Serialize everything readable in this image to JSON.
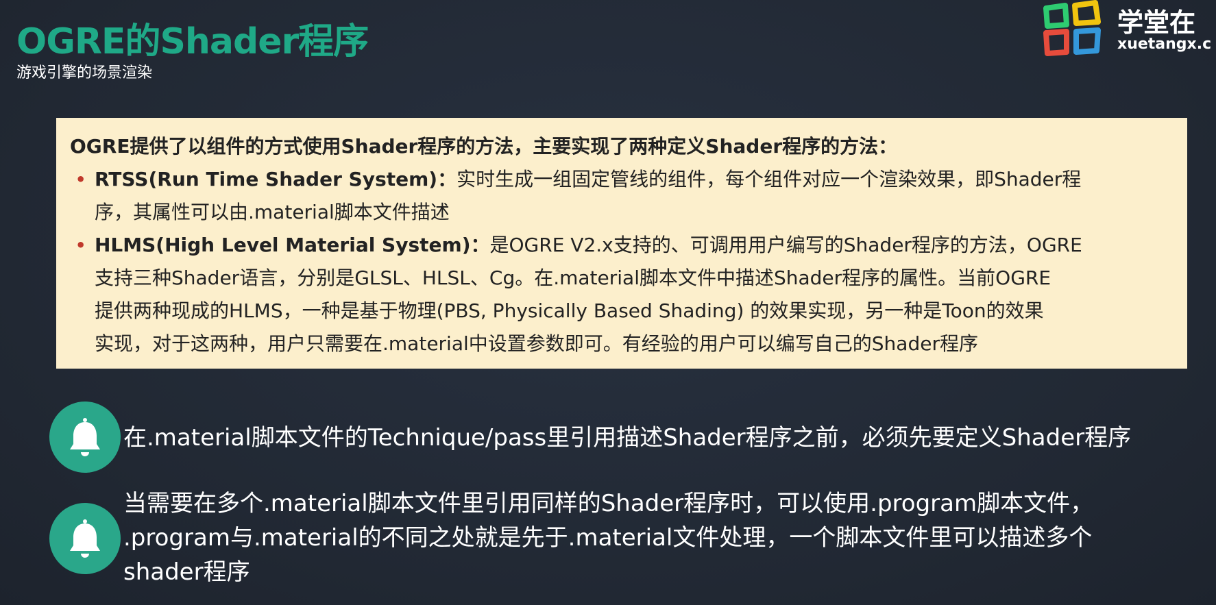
{
  "header": {
    "title": "OGRE的Shader程序",
    "subtitle": "游戏引擎的场景渲染"
  },
  "logo": {
    "name_cn": "学堂在",
    "name_en": "xuetangx.c",
    "icon": "xuetangx-logo-icon",
    "colors": [
      "#2ecc71",
      "#f1c40f",
      "#e74c3c",
      "#3498db"
    ]
  },
  "callout": {
    "intro": "OGRE提供了以组件的方式使用Shader程序的方法，主要实现了两种定义Shader程序的方法：",
    "bullets": [
      {
        "term": "RTSS(Run Time Shader System)",
        "sep": "：",
        "lines": [
          "实时生成一组固定管线的组件，每个组件对应一个渲染效果，即Shader程",
          "序，其属性可以由.material脚本文件描述"
        ]
      },
      {
        "term": "HLMS(High Level Material System)",
        "sep": "：",
        "lines": [
          "是OGRE V2.x支持的、可调用用户编写的Shader程序的方法，OGRE",
          "支持三种Shader语言，分别是GLSL、HLSL、Cg。在.material脚本文件中描述Shader程序的属性。当前OGRE",
          "提供两种现成的HLMS，一种是基于物理(PBS, Physically Based Shading) 的效果实现，另一种是Toon的效果",
          "实现，对于这两种，用户只需要在.material中设置参数即可。有经验的用户可以编写自己的Shader程序"
        ]
      }
    ]
  },
  "notes": [
    {
      "icon": "bell-icon",
      "lines": [
        "在.material脚本文件的Technique/pass里引用描述Shader程序之前，必须先要定义Shader程序"
      ]
    },
    {
      "icon": "bell-icon",
      "lines": [
        "当需要在多个.material脚本文件里引用同样的Shader程序时，可以使用.program脚本文件，",
        ".program与.material的不同之处就是先于.material文件处理，一个脚本文件里可以描述多个",
        "shader程序"
      ]
    }
  ],
  "colors": {
    "accent": "#1fa987",
    "callout_bg": "#fcefcc",
    "icon_bg": "#2aa78a",
    "bullet": "#c0392b",
    "background": "#222a35"
  }
}
